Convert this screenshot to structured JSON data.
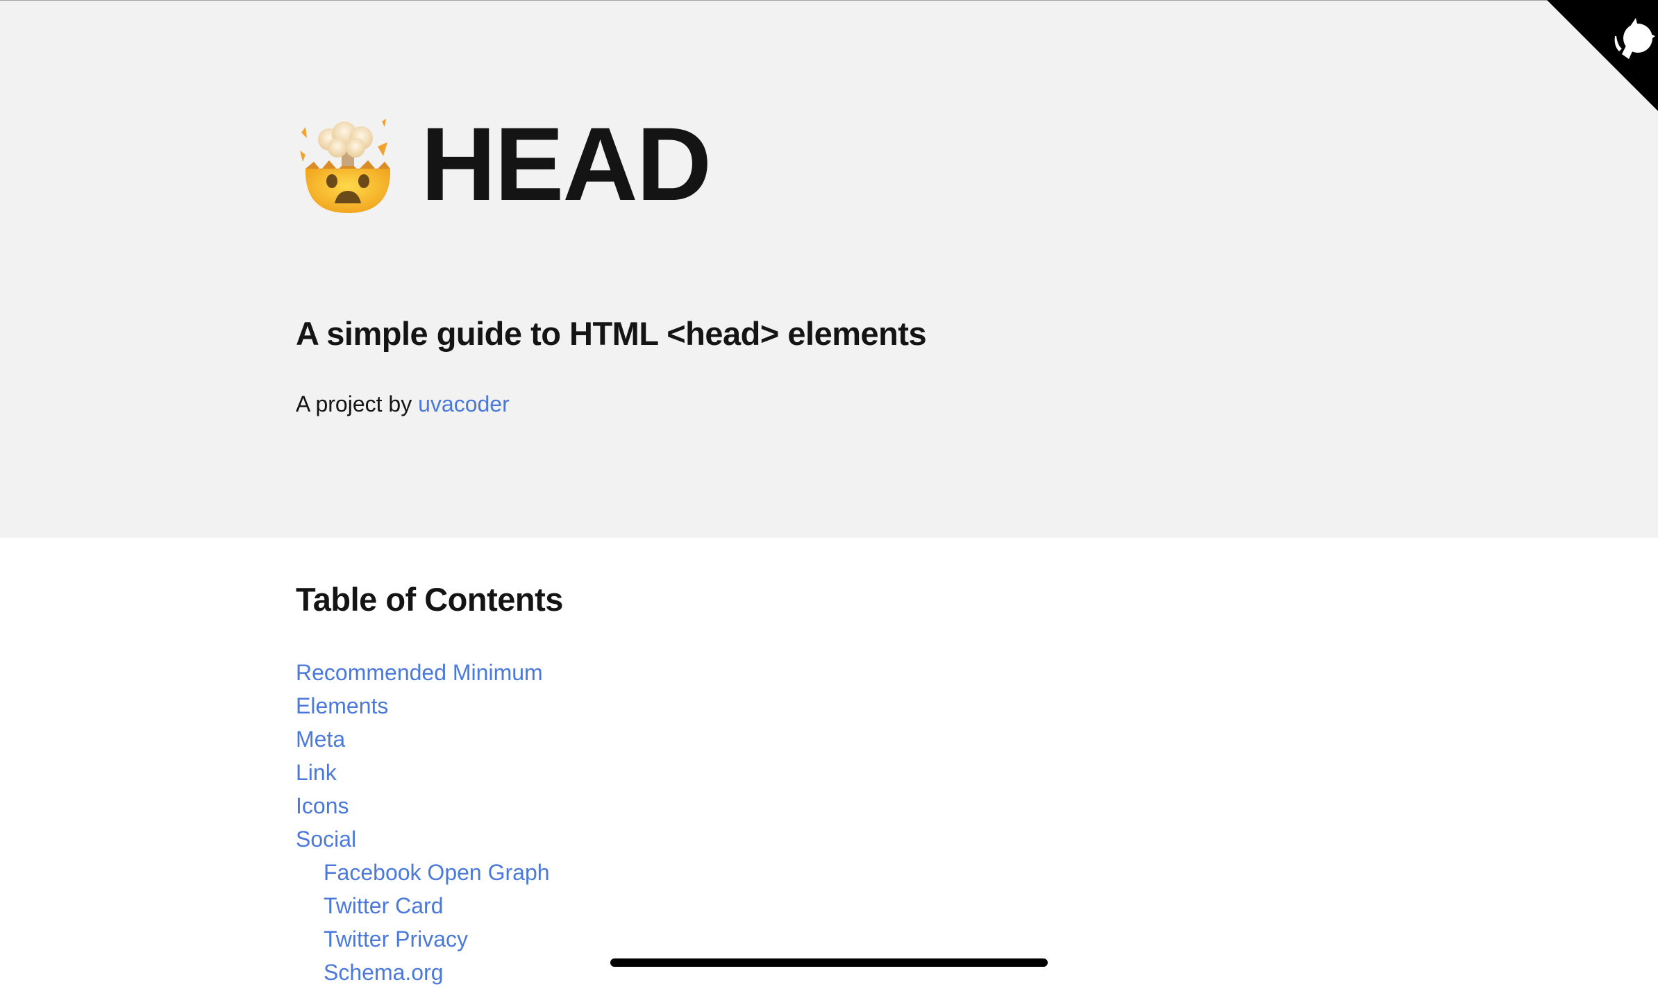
{
  "header": {
    "emoji": "exploding-head",
    "title": "HEAD",
    "subtitle": "A simple guide to HTML <head> elements",
    "byline_prefix": "A project by ",
    "author_link": "uvacoder"
  },
  "corner": {
    "icon": "github-octocat-icon",
    "bg_color": "#000000"
  },
  "toc": {
    "title": "Table of Contents",
    "items": [
      {
        "label": "Recommended Minimum",
        "level": 1
      },
      {
        "label": "Elements",
        "level": 1
      },
      {
        "label": "Meta",
        "level": 1
      },
      {
        "label": "Link",
        "level": 1
      },
      {
        "label": "Icons",
        "level": 1
      },
      {
        "label": "Social",
        "level": 1
      },
      {
        "label": "Facebook Open Graph",
        "level": 2
      },
      {
        "label": "Twitter Card",
        "level": 2
      },
      {
        "label": "Twitter Privacy",
        "level": 2
      },
      {
        "label": "Schema.org",
        "level": 2
      }
    ]
  },
  "colors": {
    "hero_bg": "#f2f2f2",
    "link": "#4a79db",
    "text": "#141414"
  }
}
